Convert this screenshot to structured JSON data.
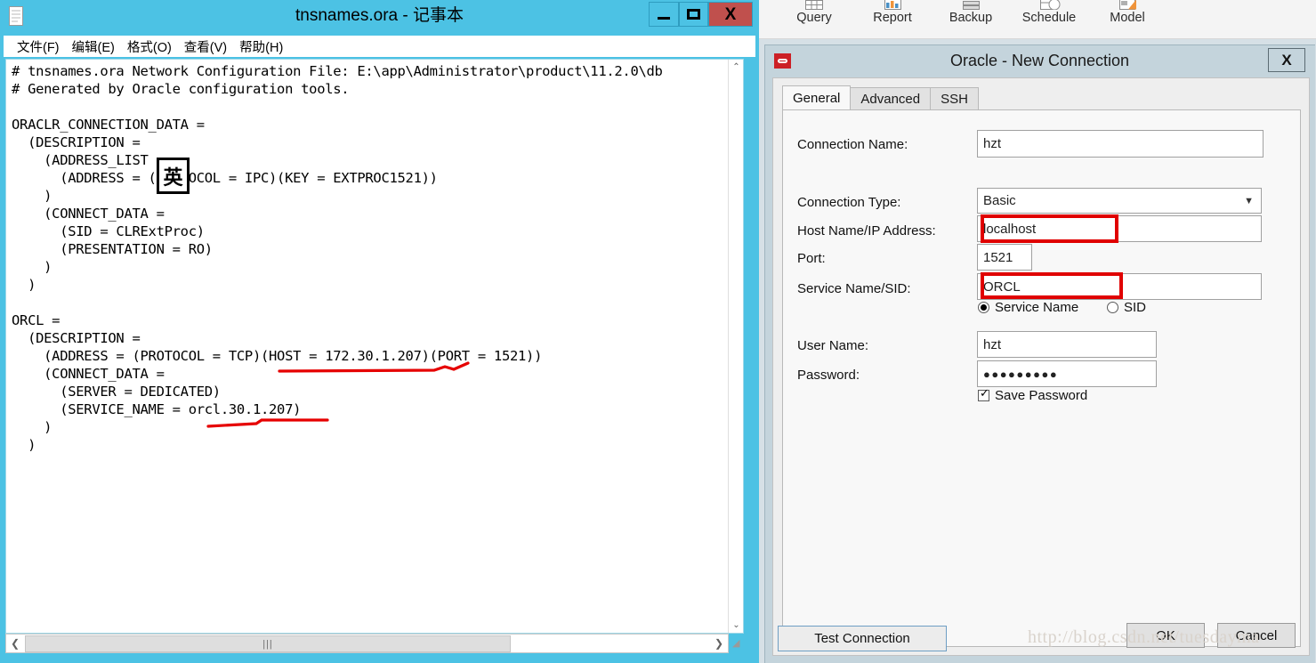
{
  "notepad": {
    "title": "tnsnames.ora - 记事本",
    "icon": "notepad-icon",
    "controls": {
      "minimize": "–",
      "maximize": "❐",
      "close": "X"
    },
    "menu": [
      "文件(F)",
      "编辑(E)",
      "格式(O)",
      "查看(V)",
      "帮助(H)"
    ],
    "content": "# tnsnames.ora Network Configuration File: E:\\app\\Administrator\\product\\11.2.0\\db\n# Generated by Oracle configuration tools.\n\nORACLR_CONNECTION_DATA =\n  (DESCRIPTION =\n    (ADDRESS_LIST =\n      (ADDRESS = (PROTOCOL = IPC)(KEY = EXTPROC1521))\n    )\n    (CONNECT_DATA =\n      (SID = CLRExtProc)\n      (PRESENTATION = RO)\n    )\n  )\n\nORCL =\n  (DESCRIPTION =\n    (ADDRESS = (PROTOCOL = TCP)(HOST = 172.30.1.207)(PORT = 1521))\n    (CONNECT_DATA =\n      (SERVER = DEDICATED)\n      (SERVICE_NAME = orcl.30.1.207)\n    )\n  )",
    "ime_indicator": "英",
    "scrollbar": {
      "up": "⌃",
      "down": "⌄",
      "left": "❮",
      "right": "❯",
      "thumb": "|||",
      "grip": "◢"
    }
  },
  "toolbar": {
    "items": [
      {
        "label": "Query",
        "icon": "grid-table-icon"
      },
      {
        "label": "Report",
        "icon": "bar-chart-icon"
      },
      {
        "label": "Backup",
        "icon": "drive-stack-icon"
      },
      {
        "label": "Schedule",
        "icon": "clock-calendar-icon"
      },
      {
        "label": "Model",
        "icon": "model-diagram-icon"
      }
    ]
  },
  "dialog": {
    "title": "Oracle - New Connection",
    "icon": "oracle-logo-icon",
    "close_label": "X",
    "tabs": [
      {
        "label": "General",
        "active": true
      },
      {
        "label": "Advanced",
        "active": false
      },
      {
        "label": "SSH",
        "active": false
      }
    ],
    "fields": {
      "connection_name_label": "Connection Name:",
      "connection_name_value": "hzt",
      "connection_type_label": "Connection Type:",
      "connection_type_value": "Basic",
      "host_label": "Host Name/IP Address:",
      "host_value": "localhost",
      "port_label": "Port:",
      "port_value": "1521",
      "service_label": "Service Name/SID:",
      "service_value": "ORCL",
      "radio_service_name": "Service Name",
      "radio_sid": "SID",
      "user_label": "User Name:",
      "user_value": "hzt",
      "password_label": "Password:",
      "password_value": "●●●●●●●●●",
      "save_password_label": "Save Password"
    },
    "buttons": {
      "test": "Test Connection",
      "ok": "OK",
      "cancel": "Cancel"
    }
  },
  "annotations": {
    "red_boxes": [
      "host-field",
      "service-field"
    ],
    "red_underlines": [
      "host-address-line",
      "service-name-line"
    ],
    "accent_red": "#e00000"
  },
  "watermark": "http://blog.csdn.net/tuesdayma"
}
